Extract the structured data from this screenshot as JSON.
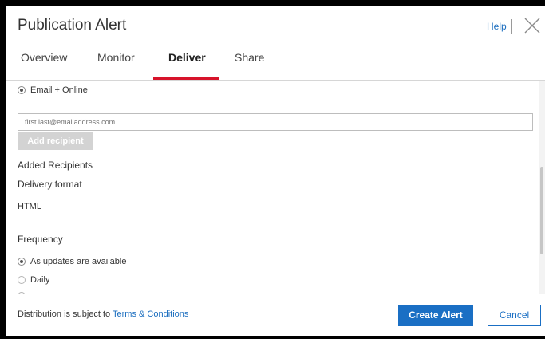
{
  "dialog": {
    "title": "Publication Alert",
    "help_label": "Help"
  },
  "tabs": [
    {
      "label": "Overview",
      "active": false
    },
    {
      "label": "Monitor",
      "active": false
    },
    {
      "label": "Deliver",
      "active": true
    },
    {
      "label": "Share",
      "active": false
    }
  ],
  "deliver": {
    "delivery_option": {
      "label": "Email + Online",
      "selected": true
    },
    "email_input": {
      "placeholder": "first.last@emailaddress.com",
      "value": ""
    },
    "add_recipient_label": "Add recipient",
    "added_recipients_label": "Added Recipients",
    "delivery_format_label": "Delivery format",
    "delivery_format_value": "HTML",
    "frequency_label": "Frequency",
    "frequency_options": [
      {
        "label": "As updates are available",
        "selected": true
      },
      {
        "label": "Daily",
        "selected": false
      }
    ]
  },
  "footer": {
    "notice_text": "Distribution is subject to ",
    "terms_link": "Terms & Conditions",
    "create_label": "Create Alert",
    "cancel_label": "Cancel"
  },
  "colors": {
    "accent": "#1a6fc4",
    "tab_underline": "#d7132a"
  }
}
